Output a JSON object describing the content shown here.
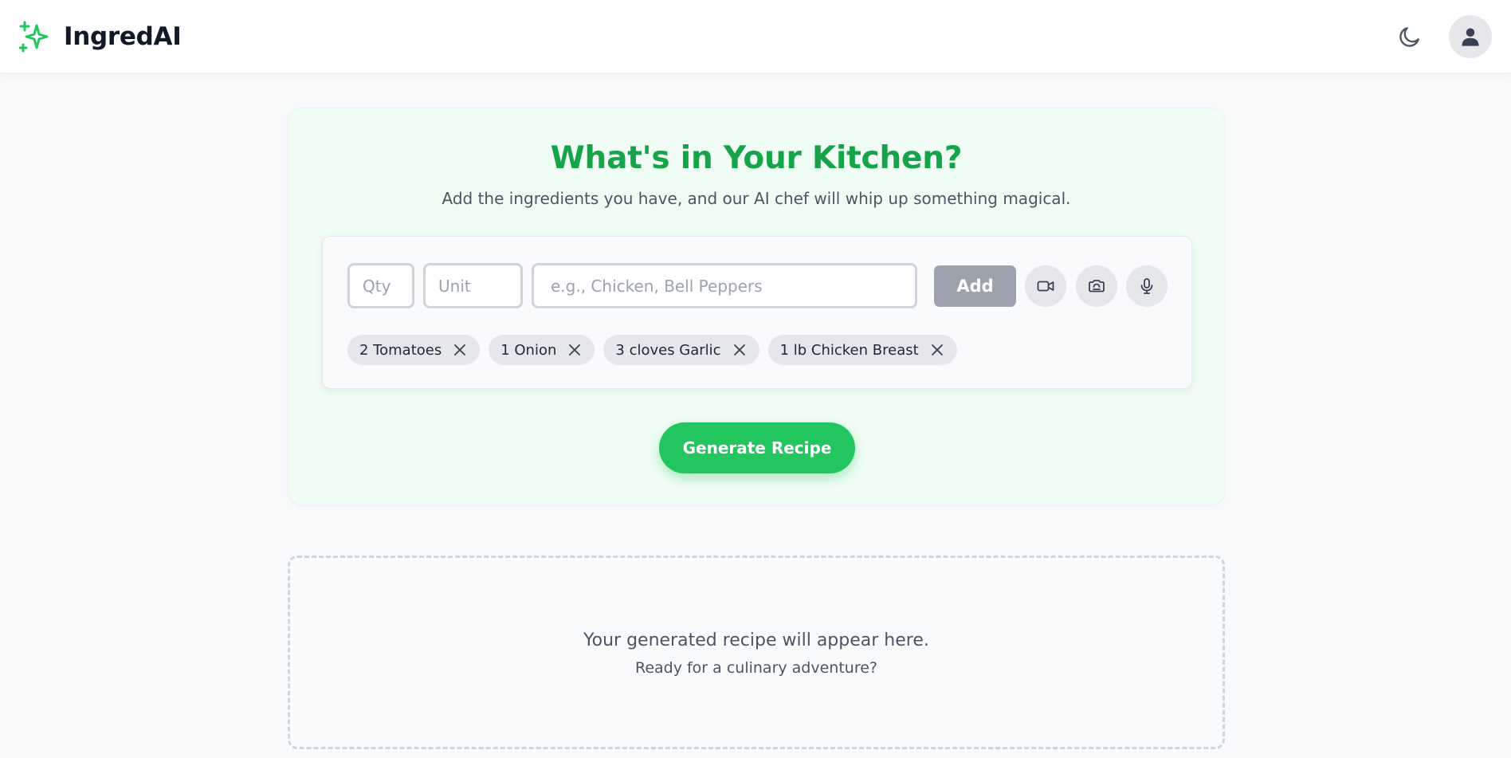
{
  "app": {
    "name": "IngredAI",
    "logo_icon": "sparkles-icon",
    "accent_color": "#22c55e"
  },
  "header": {
    "theme_toggle_icon": "moon-icon",
    "profile_icon": "user-icon"
  },
  "hero": {
    "title": "What's in Your Kitchen?",
    "subtitle": "Add the ingredients you have, and our AI chef will whip up something magical."
  },
  "input": {
    "qty_placeholder": "Qty",
    "unit_placeholder": "Unit",
    "name_placeholder": "e.g., Chicken, Bell Peppers",
    "add_label": "Add",
    "video_icon": "video-icon",
    "camera_icon": "camera-icon",
    "mic_icon": "microphone-icon"
  },
  "ingredients": [
    {
      "label": "2 Tomatoes"
    },
    {
      "label": "1 Onion"
    },
    {
      "label": "3 cloves Garlic"
    },
    {
      "label": "1 lb Chicken Breast"
    }
  ],
  "actions": {
    "generate_label": "Generate Recipe"
  },
  "result": {
    "placeholder_line1": "Your generated recipe will appear here.",
    "placeholder_line2": "Ready for a culinary adventure?"
  }
}
